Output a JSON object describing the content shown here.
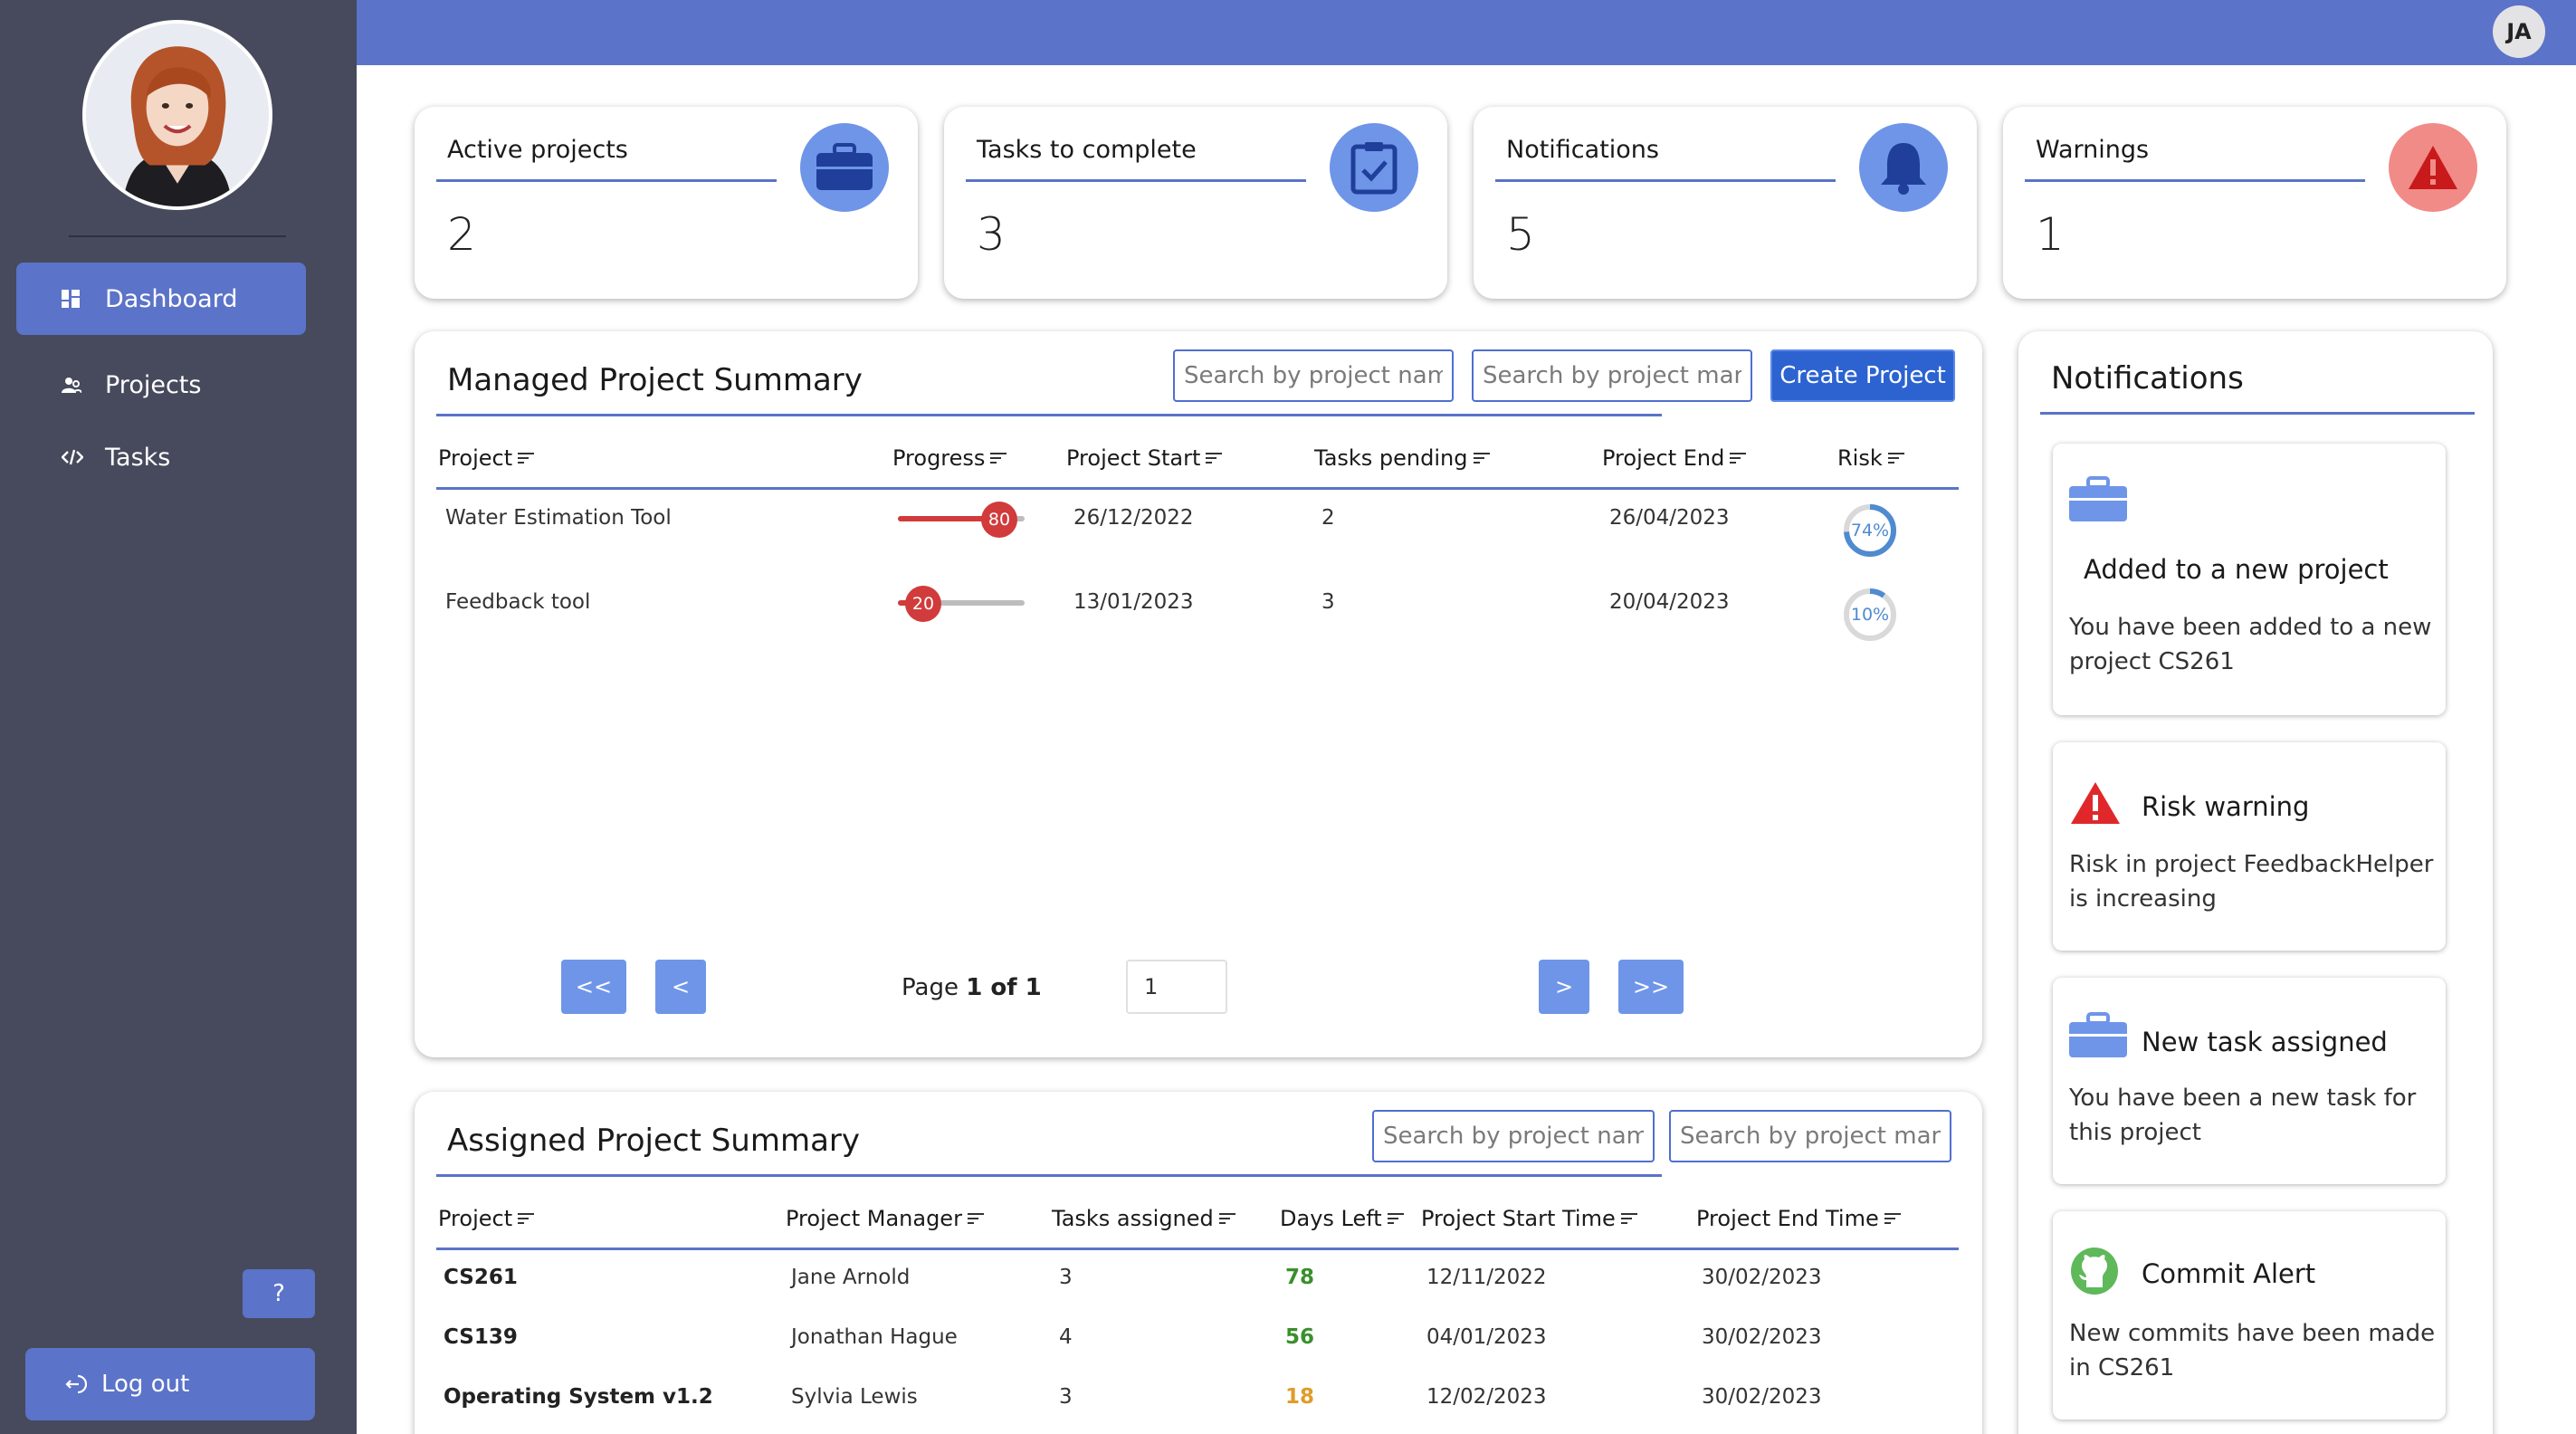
{
  "user": {
    "initials": "JA"
  },
  "sidebar": {
    "items": [
      {
        "label": "Dashboard",
        "icon": "dashboard-icon",
        "active": true
      },
      {
        "label": "Projects",
        "icon": "people-icon",
        "active": false
      },
      {
        "label": "Tasks",
        "icon": "code-icon",
        "active": false
      }
    ],
    "help_label": "?",
    "logout_label": "Log out"
  },
  "stats": [
    {
      "title": "Active projects",
      "value": "2",
      "icon": "briefcase-icon"
    },
    {
      "title": "Tasks to complete",
      "value": "3",
      "icon": "clipboard-check-icon"
    },
    {
      "title": "Notifications",
      "value": "5",
      "icon": "bell-icon"
    },
    {
      "title": "Warnings",
      "value": "1",
      "icon": "warning-icon"
    }
  ],
  "managed": {
    "title": "Managed Project Summary",
    "search_name_placeholder": "Search by project name",
    "search_manager_placeholder": "Search by project manager",
    "create_label": "Create Project",
    "columns": [
      "Project",
      "Progress",
      "Project Start",
      "Tasks pending",
      "Project End",
      "Risk"
    ],
    "rows": [
      {
        "project": "Water Estimation Tool",
        "progress": 80,
        "progress_label": "80",
        "start": "26/12/2022",
        "tasks_pending": "2",
        "end": "26/04/2023",
        "risk": 74,
        "risk_label": "74%"
      },
      {
        "project": "Feedback tool",
        "progress": 20,
        "progress_label": "20",
        "start": "13/01/2023",
        "tasks_pending": "3",
        "end": "20/04/2023",
        "risk": 10,
        "risk_label": "10%"
      }
    ],
    "pagination": {
      "first": "<<",
      "prev": "<",
      "page_prefix": "Page ",
      "page_current": "1 of 1",
      "input_value": "1",
      "next": ">",
      "last": ">>"
    }
  },
  "assigned": {
    "title": "Assigned Project Summary",
    "search_name_placeholder": "Search by project name",
    "search_manager_placeholder": "Search by project manager",
    "columns": [
      "Project",
      "Project Manager",
      "Tasks assigned",
      "Days Left",
      "Project Start Time",
      "Project End Time"
    ],
    "rows": [
      {
        "project": "CS261",
        "manager": "Jane Arnold",
        "tasks": "3",
        "days_left": "78",
        "days_status": "green",
        "start": "12/11/2022",
        "end": "30/02/2023"
      },
      {
        "project": "CS139",
        "manager": "Jonathan Hague",
        "tasks": "4",
        "days_left": "56",
        "days_status": "green",
        "start": "04/01/2023",
        "end": "30/02/2023"
      },
      {
        "project": "Operating System v1.2",
        "manager": "Sylvia Lewis",
        "tasks": "3",
        "days_left": "18",
        "days_status": "orange",
        "start": "12/02/2023",
        "end": "30/02/2023"
      }
    ]
  },
  "notifications": {
    "title": "Notifications",
    "items": [
      {
        "title": "Added to a new project",
        "body": "You have been added to a new project CS261",
        "icon": "briefcase-icon"
      },
      {
        "title": "Risk warning",
        "body": "Risk in project FeedbackHelper is increasing",
        "icon": "warning-icon"
      },
      {
        "title": "New task assigned",
        "body": "You have been a new task for this project",
        "icon": "briefcase-icon"
      },
      {
        "title": "Commit Alert",
        "body": "New commits have been made in CS261",
        "icon": "github-icon"
      }
    ]
  },
  "colors": {
    "sidebar": "#464a5c",
    "accent": "#5b73c8",
    "icon_blue": "#6f95e8",
    "danger": "#d13b3b",
    "good": "#3a8f2c",
    "caution": "#e09c2a"
  }
}
